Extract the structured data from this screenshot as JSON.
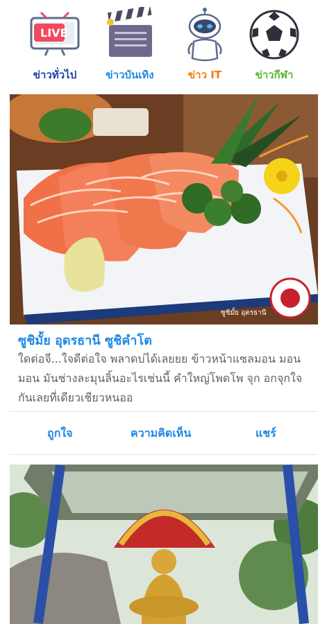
{
  "nav": {
    "items": [
      {
        "label": "ข่าวทั่วไป",
        "icon": "live-tv-icon",
        "badge": "LIVE",
        "color": "#1e3fa8"
      },
      {
        "label": "ข่าวบันเทิง",
        "icon": "clapperboard-icon",
        "color": "#1e88e5"
      },
      {
        "label": "ข่าว IT",
        "icon": "robot-icon",
        "color": "#f57c00"
      },
      {
        "label": "ข่าวกีฬา",
        "icon": "soccer-ball-icon",
        "color": "#5cb82a"
      }
    ]
  },
  "feed": {
    "posts": [
      {
        "title": "ซูชิมั้ย อุดรธานี ซูชิคำโต",
        "description": "ใดต่อจี...ใจดีต่อใจ พลาดบ่ได้เลยยย ข้าวหน้าแซลมอน มอน มอน มันช่างละมุนลิ้นอะไรเช่นนี้ คำใหญ่โพดโพ จุก อกจุกใจกันเลยที่เดียวเชียวหนออ",
        "photo_watermark": "ซูชิมั้ย อุดรธานี",
        "like_label": "ถูกใจ",
        "comment_label": "ความคิดเห็น",
        "share_label": "แชร์"
      }
    ]
  },
  "colors": {
    "accent": "#1e88e5",
    "text": "#5f5f5f"
  }
}
